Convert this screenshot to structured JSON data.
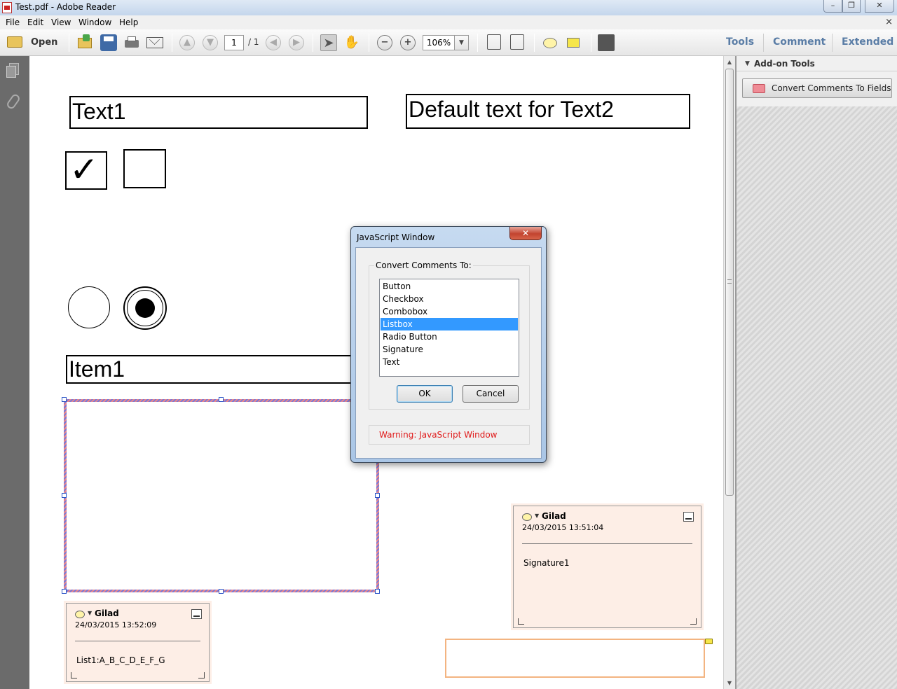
{
  "window": {
    "title": "Test.pdf - Adobe Reader",
    "controls": {
      "minimize": "–",
      "restore": "❐",
      "close": "✕"
    }
  },
  "menu": {
    "items": [
      "File",
      "Edit",
      "View",
      "Window",
      "Help"
    ],
    "close_glyph": "×"
  },
  "toolbar": {
    "open_label": "Open",
    "page_current": "1",
    "page_total": "/ 1",
    "zoom": "106%",
    "tabs": [
      "Tools",
      "Comment",
      "Extended"
    ]
  },
  "document": {
    "text1": "Text1",
    "text2": "Default text for Text2",
    "checkbox1_checked": true,
    "checkbox1_mark": "✓",
    "checkbox2_checked": false,
    "radio1_selected": false,
    "radio2_selected": true,
    "list_field_value": "Item1"
  },
  "notes": [
    {
      "author": "Gilad",
      "date": "24/03/2015 13:52:09",
      "text": "List1:A_B_C_D_E_F_G"
    },
    {
      "author": "Gilad",
      "date": "24/03/2015 13:51:04",
      "text": "Signature1"
    }
  ],
  "right_panel": {
    "section_title": "Add-on Tools",
    "button_label": "Convert Comments To Fields"
  },
  "dialog": {
    "title": "JavaScript Window",
    "close_glyph": "✕",
    "group_label": "Convert Comments To:",
    "options": [
      "Button",
      "Checkbox",
      "Combobox",
      "Listbox",
      "Radio Button",
      "Signature",
      "Text"
    ],
    "selected_option": "Listbox",
    "ok_label": "OK",
    "cancel_label": "Cancel",
    "warning": "Warning: JavaScript Window"
  },
  "colors": {
    "selection": "#3399ff",
    "warning": "#e01a1a",
    "note_background": "#fdeee6",
    "tab_text": "#5a7da6"
  }
}
